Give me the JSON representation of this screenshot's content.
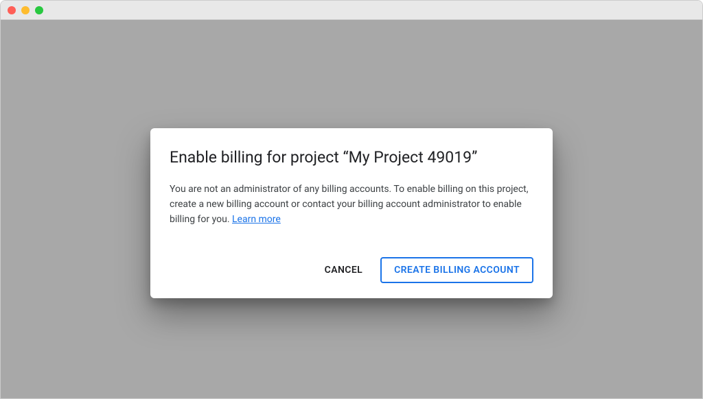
{
  "dialog": {
    "title": "Enable billing for project “My Project 49019”",
    "body_text": "You are not an administrator of any billing accounts. To enable billing on this project, create a new billing account or contact your billing account administrator to enable billing for you. ",
    "learn_more_label": "Learn more",
    "cancel_label": "CANCEL",
    "primary_label": "CREATE BILLING ACCOUNT"
  }
}
